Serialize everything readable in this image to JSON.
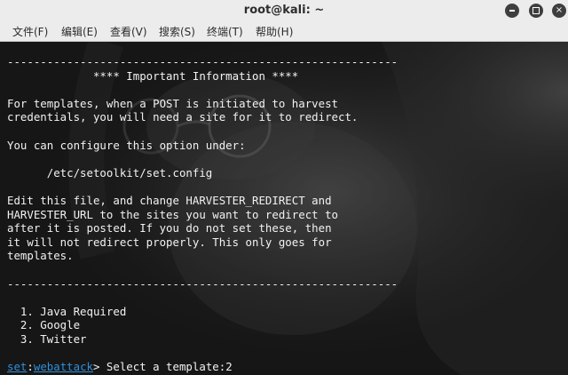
{
  "window": {
    "title": "root@kali: ~"
  },
  "menu": {
    "items": [
      "文件(F)",
      "编辑(E)",
      "查看(V)",
      "搜索(S)",
      "终端(T)",
      "帮助(H)"
    ]
  },
  "terminal": {
    "lines": [
      "-----------------------------------------------------------",
      "             **** Important Information ****",
      "",
      "For templates, when a POST is initiated to harvest",
      "credentials, you will need a site for it to redirect.",
      "",
      "You can configure this option under:",
      "",
      "      /etc/setoolkit/set.config",
      "",
      "Edit this file, and change HARVESTER_REDIRECT and",
      "HARVESTER_URL to the sites you want to redirect to",
      "after it is posted. If you do not set these, then",
      "it will not redirect properly. This only goes for",
      "templates.",
      "",
      "-----------------------------------------------------------",
      "",
      "  1. Java Required",
      "  2. Google",
      "  3. Twitter",
      ""
    ],
    "prompt": {
      "set": "set",
      "separator": ":",
      "module": "webattack",
      "tail": "> Select a template:",
      "input": "2"
    }
  },
  "colors": {
    "prompt_link": "#2f8fd8",
    "terminal_text": "#f2f2f2",
    "terminal_background": "#161616",
    "chrome_background": "#ececec"
  }
}
